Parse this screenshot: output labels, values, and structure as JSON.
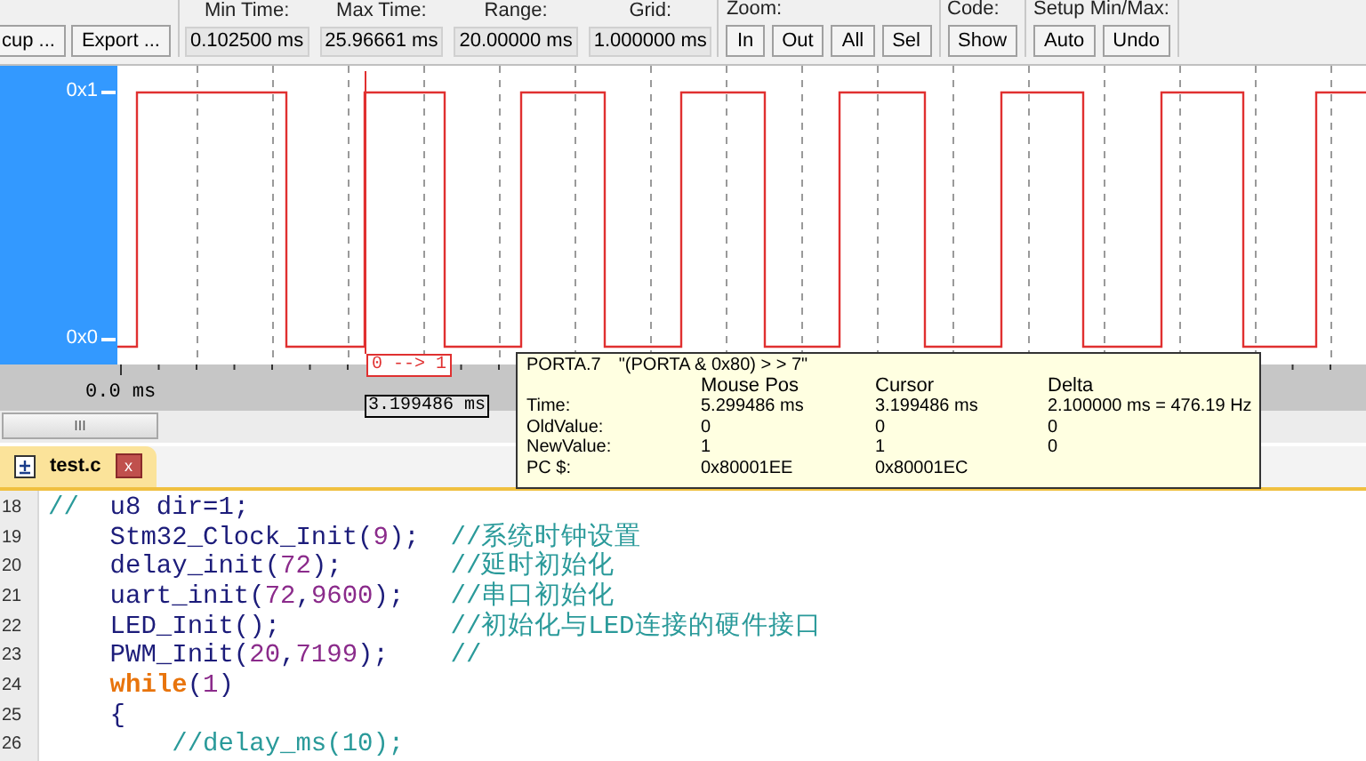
{
  "toolbar": {
    "left_buttons": [
      "cup ...",
      "Export ..."
    ],
    "fields": [
      {
        "label": "Min Time:",
        "value": "0.102500 ms"
      },
      {
        "label": "Max Time:",
        "value": "25.96661 ms"
      },
      {
        "label": "Range:",
        "value": "20.00000 ms"
      },
      {
        "label": "Grid:",
        "value": "1.000000 ms"
      }
    ],
    "groups": [
      {
        "label": "Zoom:",
        "buttons": [
          "In",
          "Out",
          "All",
          "Sel"
        ]
      },
      {
        "label": "Code:",
        "buttons": [
          "Show"
        ]
      },
      {
        "label": "Setup Min/Max:",
        "buttons": [
          "Auto",
          "Undo"
        ]
      }
    ]
  },
  "analyzer": {
    "signal_labels": [
      "0x1",
      "0x0"
    ],
    "axis_label": "0.0 ms",
    "cursor_transition": "0 --> 1",
    "cursor_time": "3.199486 ms",
    "scroll_thumb": "III",
    "tooltip": {
      "signal": "PORTA.7",
      "expression": "\"(PORTA & 0x80) > > 7\"",
      "columns": [
        "Mouse Pos",
        "Cursor",
        "Delta"
      ],
      "rows": [
        {
          "label": "Time:",
          "values": [
            "5.299486 ms",
            "3.199486 ms",
            "2.100000 ms = 476.19 Hz"
          ]
        },
        {
          "label": "OldValue:",
          "values": [
            "0",
            "0",
            "0"
          ]
        },
        {
          "label": "NewValue:",
          "values": [
            "1",
            "1",
            "0"
          ]
        },
        {
          "label": "PC $:",
          "values": [
            "0x80001EE",
            "0x80001EC"
          ]
        }
      ]
    }
  },
  "editor": {
    "tabs": [
      {
        "name": "test.c",
        "close": "x",
        "selected": true
      }
    ],
    "lines": [
      {
        "number": "18",
        "segments": [
          {
            "kind": "comment",
            "text": "//"
          },
          {
            "kind": "plain",
            "text": "  u8 dir=1;"
          }
        ]
      },
      {
        "number": "19",
        "segments": [
          {
            "kind": "plain",
            "text": "    Stm32_Clock_Init("
          },
          {
            "kind": "number",
            "text": "9"
          },
          {
            "kind": "plain",
            "text": ");  "
          },
          {
            "kind": "comment",
            "text": "//系统时钟设置"
          }
        ]
      },
      {
        "number": "20",
        "segments": [
          {
            "kind": "plain",
            "text": "    delay_init("
          },
          {
            "kind": "number",
            "text": "72"
          },
          {
            "kind": "plain",
            "text": ");       "
          },
          {
            "kind": "comment",
            "text": "//延时初始化"
          }
        ]
      },
      {
        "number": "21",
        "segments": [
          {
            "kind": "plain",
            "text": "    uart_init("
          },
          {
            "kind": "number",
            "text": "72"
          },
          {
            "kind": "plain",
            "text": ","
          },
          {
            "kind": "number",
            "text": "9600"
          },
          {
            "kind": "plain",
            "text": ");   "
          },
          {
            "kind": "comment",
            "text": "//串口初始化"
          }
        ]
      },
      {
        "number": "22",
        "segments": [
          {
            "kind": "plain",
            "text": "    LED_Init();           "
          },
          {
            "kind": "comment",
            "text": "//初始化与LED连接的硬件接口"
          }
        ]
      },
      {
        "number": "23",
        "segments": [
          {
            "kind": "plain",
            "text": "    PWM_Init("
          },
          {
            "kind": "number",
            "text": "20"
          },
          {
            "kind": "plain",
            "text": ","
          },
          {
            "kind": "number",
            "text": "7199"
          },
          {
            "kind": "plain",
            "text": ");    "
          },
          {
            "kind": "comment",
            "text": "//"
          }
        ]
      },
      {
        "number": "24",
        "segments": [
          {
            "kind": "keyword",
            "text": "    while"
          },
          {
            "kind": "plain",
            "text": "("
          },
          {
            "kind": "number",
            "text": "1"
          },
          {
            "kind": "plain",
            "text": ")"
          }
        ]
      },
      {
        "number": "25",
        "segments": [
          {
            "kind": "plain",
            "text": "    {"
          }
        ]
      },
      {
        "number": "26",
        "segments": [
          {
            "kind": "comment",
            "text": "        //delay_ms(10);"
          }
        ]
      }
    ]
  }
}
